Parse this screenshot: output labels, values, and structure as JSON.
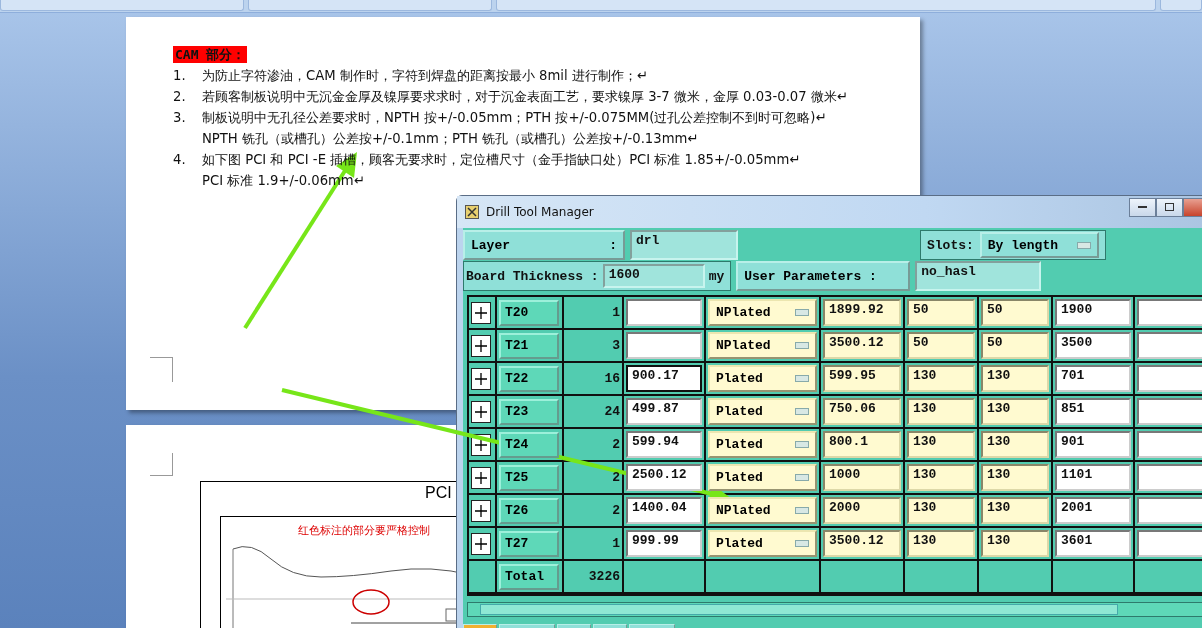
{
  "document": {
    "heading": "CAM 部分：",
    "items": [
      {
        "number": "1.",
        "lines": [
          "为防止字符渗油，CAM 制作时，字符到焊盘的距离按最小 8mil 进行制作；↵"
        ]
      },
      {
        "number": "2.",
        "lines": [
          "若顾客制板说明中无沉金金厚及镍厚要求求时，对于沉金表面工艺，要求镍厚 3-7 微米，金厚 0.03-0.07 微米↵"
        ]
      },
      {
        "number": "3.",
        "lines": [
          "制板说明中无孔径公差要求时，NPTH 按+/-0.05mm；PTH 按+/-0.075MM(过孔公差控制不到时可忽略)↵",
          "NPTH 铣孔（或槽孔）公差按+/-0.1mm；PTH 铣孔（或槽孔）公差按+/-0.13mm↵"
        ]
      },
      {
        "number": "4.",
        "lines": [
          "如下图 PCI 和 PCI -E 插槽，顾客无要求时，定位槽尺寸（金手指缺口处）PCI 标准 1.85+/-0.05mm↵",
          "PCI 标准 1.9+/-0.06mm↵"
        ]
      }
    ],
    "figure": {
      "title": "PCI",
      "note": "红色标注的部分要严格控制"
    }
  },
  "drill_tool_manager": {
    "title": "Drill Tool Manager",
    "layer_label": "Layer",
    "layer_colon": ":",
    "layer": "drl",
    "slots_label": "Slots:",
    "slots": "By length",
    "thickness_label": "Board Thickness :",
    "thickness": "1600",
    "thickness_unit": "my",
    "user_params_label": "User Parameters :",
    "user_params": "no_hasl",
    "rows": [
      {
        "tool": "T20",
        "count": "1",
        "type": "NPlated",
        "values": [
          "1899.92",
          "50",
          "50",
          "1900"
        ],
        "selected": false
      },
      {
        "tool": "T21",
        "count": "3",
        "type": "NPlated",
        "values": [
          "3500.12",
          "50",
          "50",
          "3500"
        ],
        "selected": false
      },
      {
        "tool": "T22",
        "count": "16",
        "size": "900.17",
        "type": "Plated",
        "values": [
          "599.95",
          "130",
          "130",
          "701"
        ],
        "selected": true
      },
      {
        "tool": "T23",
        "count": "24",
        "size": "499.87",
        "type": "Plated",
        "values": [
          "750.06",
          "130",
          "130",
          "851"
        ],
        "selected": false
      },
      {
        "tool": "T24",
        "count": "2",
        "size": "599.94",
        "type": "Plated",
        "values": [
          "800.1",
          "130",
          "130",
          "901"
        ],
        "selected": false
      },
      {
        "tool": "T25",
        "count": "2",
        "size": "2500.12",
        "type": "Plated",
        "values": [
          "1000",
          "130",
          "130",
          "1101"
        ],
        "selected": false
      },
      {
        "tool": "T26",
        "count": "2",
        "size": "1400.04",
        "type": "NPlated",
        "values": [
          "2000",
          "130",
          "130",
          "2001"
        ],
        "selected": false
      },
      {
        "tool": "T27",
        "count": "1",
        "size": "999.99",
        "type": "Plated",
        "values": [
          "3500.12",
          "130",
          "130",
          "3601"
        ],
        "selected": false
      }
    ],
    "total_label": "Total",
    "total": "3226"
  }
}
